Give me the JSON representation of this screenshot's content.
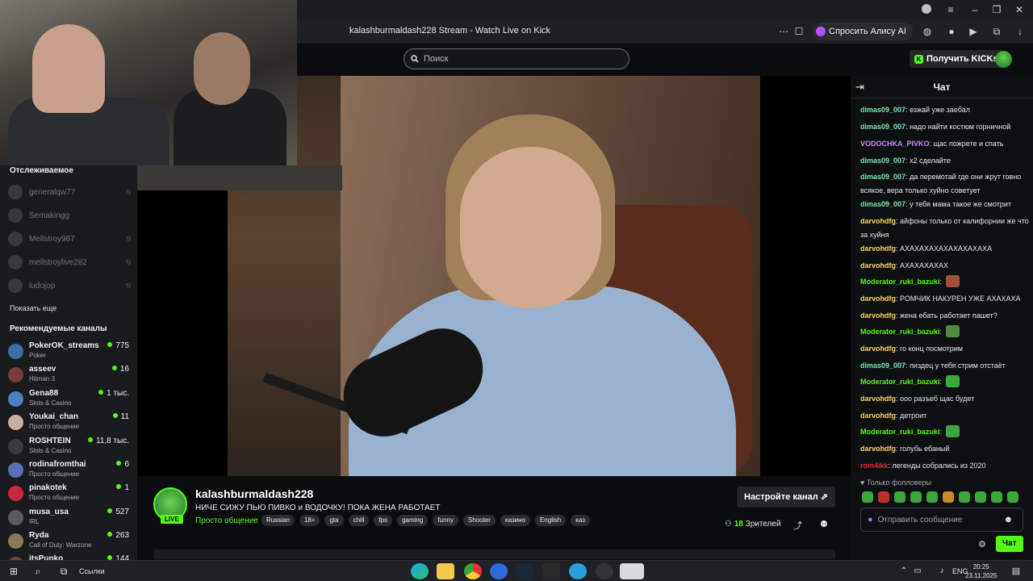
{
  "browser": {
    "page_title": "kalashburmaldash228 Stream - Watch Live on Kick",
    "alice_button": "Спросить Алису AI"
  },
  "header": {
    "search_placeholder": "Поиск",
    "get_kicks": "Получить KICKs"
  },
  "sidebar": {
    "following_title": "Отслеживаемое",
    "following": [
      {
        "name": "generalqw77"
      },
      {
        "name": "Semakingg"
      },
      {
        "name": "Mellstroy987"
      },
      {
        "name": "mellstroylive282"
      },
      {
        "name": "ludojop"
      }
    ],
    "show_more": "Показать еще",
    "recommended_title": "Рекомендуемые каналы",
    "recommended": [
      {
        "name": "PokerOK_streams",
        "category": "Poker",
        "viewers": "775",
        "color": "#3a6fa8"
      },
      {
        "name": "asseev",
        "category": "Hitman 3",
        "viewers": "16",
        "color": "#7a3b3b"
      },
      {
        "name": "Gena88",
        "category": "Slots & Casino",
        "viewers": "1 тыс.",
        "color": "#4a7fc1"
      },
      {
        "name": "Youkai_chan",
        "category": "Просто общение",
        "viewers": "11",
        "color": "#c9b0a0"
      },
      {
        "name": "ROSHTEIN",
        "category": "Slots & Casino",
        "viewers": "11,8 тыс.",
        "color": "#3a3a3a"
      },
      {
        "name": "rodinafromthai",
        "category": "Просто общение",
        "viewers": "6",
        "color": "#5a6fb8"
      },
      {
        "name": "pinakotek",
        "category": "Просто общение",
        "viewers": "1",
        "color": "#c8283a"
      },
      {
        "name": "musa_usa",
        "category": "IRL",
        "viewers": "527",
        "color": "#5a5a5a"
      },
      {
        "name": "Ryda",
        "category": "Call of Duty: Warzone",
        "viewers": "263",
        "color": "#8a7a5a"
      },
      {
        "name": "itsPunko",
        "category": "",
        "viewers": "144",
        "color": "#6a4a3a"
      }
    ]
  },
  "channel": {
    "name": "kalashburmaldash228",
    "live_badge": "LIVE",
    "title": "НИЧЕ СИЖУ ПЬЮ ПИВКО и ВОДОЧКУ! ПОКА ЖЕНА РАБОТАЕТ",
    "category": "Просто общение",
    "tags": [
      "Russian",
      "18+",
      "gta",
      "chill",
      "fps",
      "gaming",
      "funny",
      "Shooter",
      "казино",
      "English",
      "каз"
    ],
    "customize_button": "Настройте канал",
    "viewers_count": "18",
    "viewers_label": "Зрителей"
  },
  "chat": {
    "title": "Чат",
    "messages": [
      {
        "user": "dimas09_007",
        "color": "#7fe7b5",
        "text": "езжай уже заебал"
      },
      {
        "user": "dimas09_007",
        "color": "#7fe7b5",
        "text": "надо найти костюм горничной"
      },
      {
        "user": "VODOCHKA_PIVKO",
        "color": "#c88cff",
        "text": "щас пожрете и спать"
      },
      {
        "user": "dimas09_007",
        "color": "#7fe7b5",
        "text": "х2 сделайте"
      },
      {
        "user": "dimas09_007",
        "color": "#7fe7b5",
        "text": "да перемотай где они жрут говно всякое, вера только хуйно советует"
      },
      {
        "user": "dimas09_007",
        "color": "#7fe7b5",
        "text": "у тебя мама такое же смотрит"
      },
      {
        "user": "darvohdfg",
        "color": "#ffd36b",
        "text": "айфоны только от калифорнии же что за хуйня"
      },
      {
        "user": "darvohdfg",
        "color": "#ffd36b",
        "text": "АХАХАХАХАХАХАХАХАХА"
      },
      {
        "user": "darvohdfg",
        "color": "#ffd36b",
        "text": "АХАХАХАХАХ"
      },
      {
        "user": "Moderator_ruki_bazuki",
        "color": "#53fc18",
        "text": "",
        "emote": "#a0503a"
      },
      {
        "user": "darvohdfg",
        "color": "#ffd36b",
        "text": "РОМЧИК НАКУРЕН УЖЕ АХАХАХА"
      },
      {
        "user": "darvohdfg",
        "color": "#ffd36b",
        "text": "жена ебать работает пашет?"
      },
      {
        "user": "Moderator_ruki_bazuki",
        "color": "#53fc18",
        "text": "",
        "emote": "#4f8a3a"
      },
      {
        "user": "darvohdfg",
        "color": "#ffd36b",
        "text": "го конц посмотрим"
      },
      {
        "user": "dimas09_007",
        "color": "#7fe7b5",
        "text": "пиздец у тебя стрим отстаёт"
      },
      {
        "user": "Moderator_ruki_bazuki",
        "color": "#53fc18",
        "text": "",
        "emote": "#3aa83a"
      },
      {
        "user": "darvohdfg",
        "color": "#ffd36b",
        "text": "ооо разъеб щас будет"
      },
      {
        "user": "darvohdfg",
        "color": "#ffd36b",
        "text": "детроит"
      },
      {
        "user": "Moderator_ruki_bazuki",
        "color": "#53fc18",
        "text": "",
        "emote": "#3aa83a"
      },
      {
        "user": "darvohdfg",
        "color": "#ffd36b",
        "text": "голубь ебаный"
      },
      {
        "user": "rom4ikk",
        "color": "#e0303a",
        "text": "легенды собрались из 2020"
      }
    ],
    "followers_only": "Только фолловеры",
    "input_placeholder": "Отправить сообщение",
    "send_button": "Чат"
  },
  "taskbar": {
    "links_label": "Ссылки",
    "language": "ENG",
    "time": "20:25",
    "date": "23.11.2025"
  },
  "colors": {
    "accent": "#53fc18",
    "background": "#0b0c0d",
    "sidebar": "#191b1f"
  }
}
